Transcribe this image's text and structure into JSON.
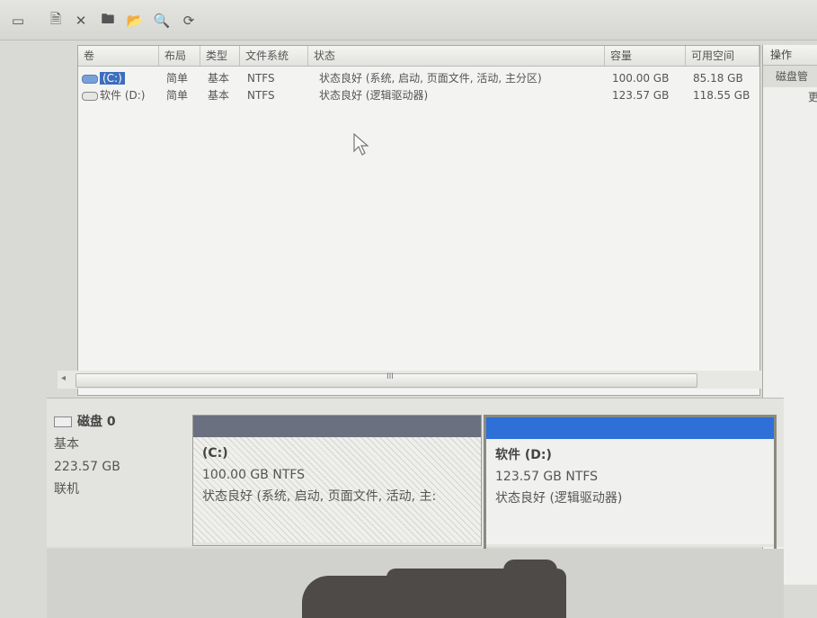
{
  "toolbar": {
    "buttons": [
      {
        "icon": "console-icon",
        "glyph": "▭"
      },
      {
        "icon": "properties-icon",
        "glyph": "🗎"
      },
      {
        "icon": "delete-icon",
        "glyph": "✕"
      },
      {
        "icon": "new-folder-icon",
        "glyph": "🖿"
      },
      {
        "icon": "open-icon",
        "glyph": "📂"
      },
      {
        "icon": "search-icon",
        "glyph": "🔍"
      },
      {
        "icon": "refresh-icon",
        "glyph": "⟳"
      }
    ]
  },
  "volume_list": {
    "columns": [
      "卷",
      "布局",
      "类型",
      "文件系统",
      "状态",
      "容量",
      "可用空间"
    ],
    "rows": [
      {
        "volume": "(C:)",
        "layout": "简单",
        "type": "基本",
        "fs": "NTFS",
        "status": "状态良好 (系统, 启动, 页面文件, 活动, 主分区)",
        "capacity": "100.00 GB",
        "free": "85.18 GB",
        "selected": true
      },
      {
        "volume": "软件 (D:)",
        "layout": "简单",
        "type": "基本",
        "fs": "NTFS",
        "status": "状态良好 (逻辑驱动器)",
        "capacity": "123.57 GB",
        "free": "118.55 GB",
        "selected": false
      }
    ]
  },
  "scrollbar": {
    "grip": "III",
    "left_arrow": "◂",
    "right_arrow": "▸"
  },
  "actions": {
    "title": "操作",
    "item": "磁盘管",
    "sub": "更"
  },
  "disk": {
    "name": "磁盘 0",
    "type": "基本",
    "size": "223.57 GB",
    "status": "联机",
    "partitions": [
      {
        "name": "(C:)",
        "size_fs": "100.00 GB NTFS",
        "status": "状态良好 (系统, 启动, 页面文件, 活动, 主:",
        "bar_color": "#6b7080"
      },
      {
        "name": "软件  (D:)",
        "size_fs": "123.57 GB NTFS",
        "status": "状态良好 (逻辑驱动器)",
        "bar_color": "#2f6fd8"
      }
    ]
  },
  "colors": {
    "selection": "#3d6ebd",
    "logical_drive": "#2f6fd8",
    "primary_partition": "#6b7080"
  }
}
